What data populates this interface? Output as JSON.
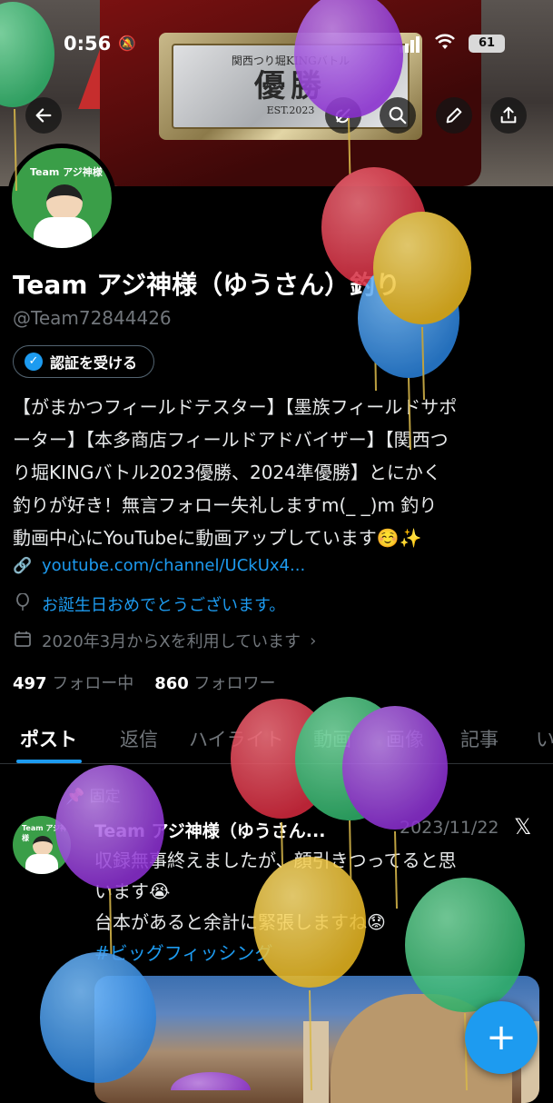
{
  "status_bar": {
    "time": "0:56",
    "battery": "61"
  },
  "banner": {
    "plaque_top": "関西つり堀KINGバトル",
    "plaque_main": "優勝",
    "plaque_est": "EST.2023"
  },
  "avatar": {
    "team_text": "Team アジ神様"
  },
  "profile": {
    "name": "Team アジ神様（ゆうさん）釣り",
    "handle": "@Team72844426",
    "verify_label": "認証を受ける",
    "bio_lines": [
      "【がまかつフィールドテスター】【墨族フィールドサポ",
      "ーター】【本多商店フィールドアドバイザー】【関西つ",
      "り堀KINGバトル2023優勝、2024準優勝】とにかく",
      "釣りが好き！無言フォロー失礼しますm(_ _)m 釣り",
      "動画中心にYouTubeに動画アップしています☺️✨"
    ],
    "link": "youtube.com/channel/UCkUx4...",
    "birthday": "お誕生日おめでとうございます。",
    "joined": "2020年3月からXを利用しています",
    "following_count": "497",
    "following_label": "フォロー中",
    "followers_count": "860",
    "followers_label": "フォロワー"
  },
  "tabs": [
    "ポスト",
    "返信",
    "ハイライト",
    "動画",
    "画像",
    "記事",
    "い"
  ],
  "post": {
    "pinned_label": "固定",
    "author": "Team アジ神様（ゆうさん...",
    "date": "2023/11/22",
    "lines": [
      "収録無事終えましたが、顔引きつってると思",
      "います😭",
      "台本があると余計に緊張しますね😟"
    ],
    "hashtag": "#ビッグフィッシング"
  },
  "fab_label": "+",
  "icons": {
    "back": "arrow-left-icon",
    "grok": "grok-icon",
    "search": "search-icon",
    "edit": "pencil-icon",
    "share": "share-icon",
    "link": "link-icon",
    "balloon": "balloon-icon",
    "calendar": "calendar-icon",
    "pin": "pin-icon",
    "x_logo": "x-logo-icon",
    "compose": "plus-icon"
  },
  "colors": {
    "accent": "#1d9bf0",
    "background": "#000000",
    "secondary_text": "#71767b"
  }
}
